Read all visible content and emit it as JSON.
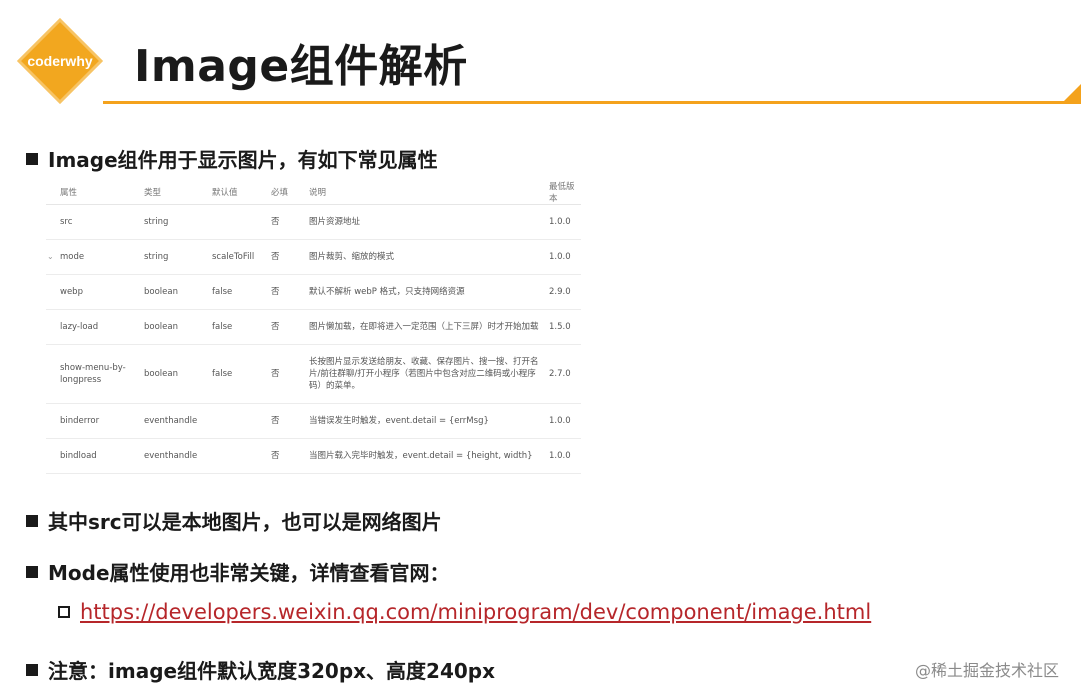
{
  "brand": {
    "logo_text": "coderwhy",
    "accent_color": "#f4a21c"
  },
  "title": "Image组件解析",
  "bullet1": "Image组件用于显示图片，有如下常见属性",
  "table": {
    "headers": [
      "属性",
      "类型",
      "默认值",
      "必填",
      "说明",
      "最低版本"
    ],
    "rows": [
      {
        "name": "src",
        "type": "string",
        "default": "",
        "required": "否",
        "desc": "图片资源地址",
        "version": "1.0.0"
      },
      {
        "name": "mode",
        "type": "string",
        "default": "scaleToFill",
        "required": "否",
        "desc": "图片裁剪、缩放的模式",
        "version": "1.0.0"
      },
      {
        "name": "webp",
        "type": "boolean",
        "default": "false",
        "required": "否",
        "desc": "默认不解析 webP 格式，只支持网络资源",
        "version": "2.9.0"
      },
      {
        "name": "lazy-load",
        "type": "boolean",
        "default": "false",
        "required": "否",
        "desc": "图片懒加载，在即将进入一定范围（上下三屏）时才开始加载",
        "version": "1.5.0"
      },
      {
        "name": "show-menu-by-longpress",
        "type": "boolean",
        "default": "false",
        "required": "否",
        "desc": "长按图片显示发送给朋友、收藏、保存图片、搜一搜、打开名片/前往群聊/打开小程序（若图片中包含对应二维码或小程序码）的菜单。",
        "version": "2.7.0"
      },
      {
        "name": "binderror",
        "type": "eventhandle",
        "default": "",
        "required": "否",
        "desc": "当错误发生时触发，event.detail = {errMsg}",
        "version": "1.0.0"
      },
      {
        "name": "bindload",
        "type": "eventhandle",
        "default": "",
        "required": "否",
        "desc": "当图片载入完毕时触发，event.detail = {height, width}",
        "version": "1.0.0"
      }
    ]
  },
  "bullet2": "其中src可以是本地图片，也可以是网络图片",
  "bullet3": "Mode属性使用也非常关键，详情查看官网：",
  "link_url": "https://developers.weixin.qq.com/miniprogram/dev/component/image.html",
  "bullet4": "注意：image组件默认宽度320px、高度240px",
  "watermark": "@稀土掘金技术社区"
}
